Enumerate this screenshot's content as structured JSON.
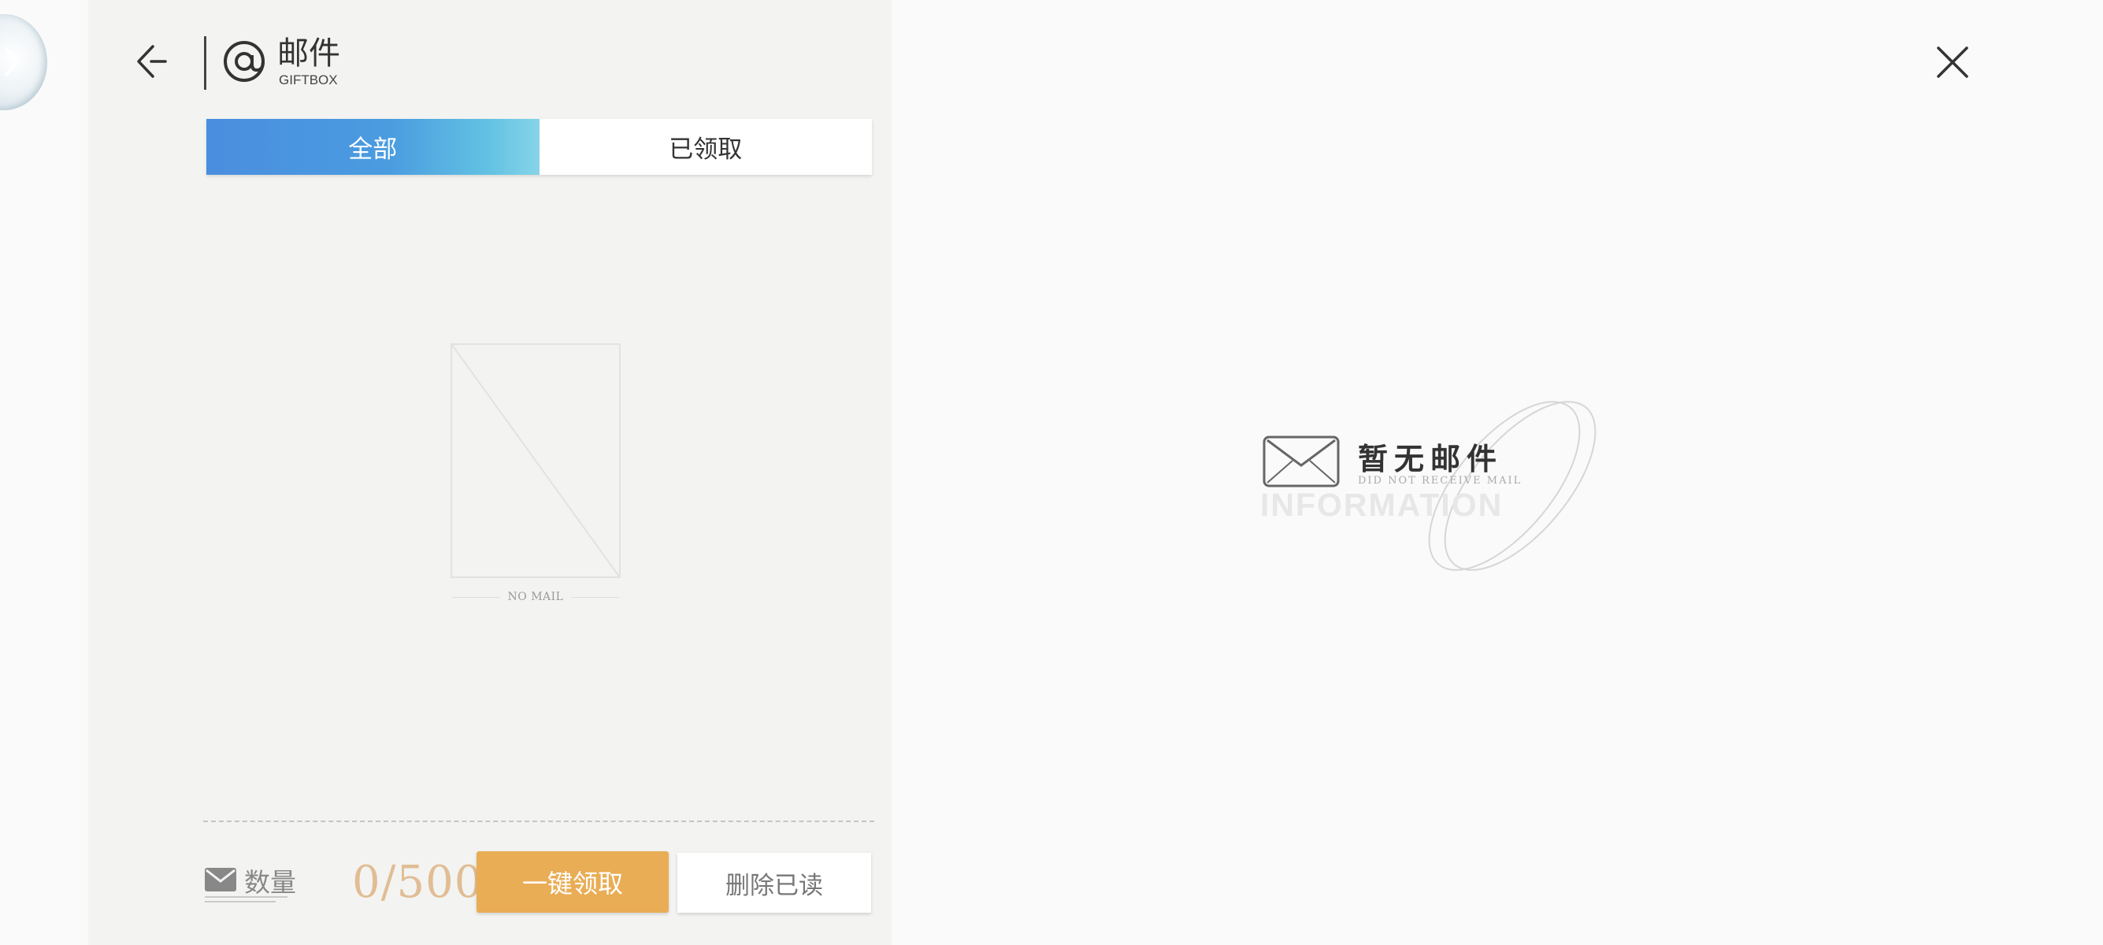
{
  "header": {
    "title": "邮件",
    "subtitle": "GIFTBOX"
  },
  "tabs": [
    {
      "label": "全部",
      "active": true
    },
    {
      "label": "已领取",
      "active": false
    }
  ],
  "mail_list": {
    "placeholder_label": "NO MAIL"
  },
  "footer": {
    "count_label": "数量",
    "count_value": "0/500",
    "claim_all_label": "一键领取",
    "delete_read_label": "删除已读"
  },
  "detail": {
    "empty_title": "暂无邮件",
    "empty_subtitle": "DID NOT RECEIVE MAIL",
    "empty_watermark": "INFORMATION"
  },
  "colors": {
    "tab_active_start": "#4a8edf",
    "tab_active_end": "#86d4e8",
    "claim_button": "#e9ad55",
    "count_value": "#e1bd94"
  },
  "icons": {
    "back": "arrow-left-icon",
    "at": "at-sign-icon",
    "close": "close-icon",
    "mail": "envelope-icon"
  }
}
